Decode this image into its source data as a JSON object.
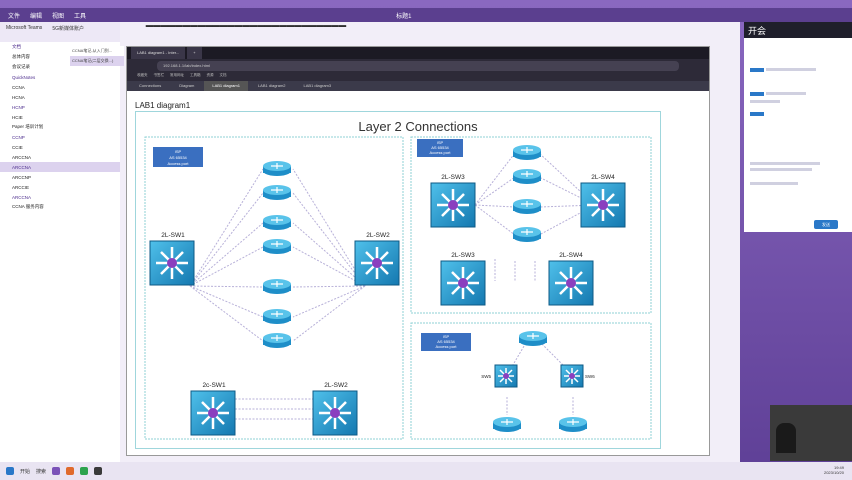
{
  "menu": {
    "items": [
      "文件",
      "编辑",
      "视图",
      "工具"
    ],
    "tab_center": "标题1"
  },
  "left_panel": {
    "header": [
      "Microsoft Teams",
      "5G新媒体账户"
    ],
    "items": [
      {
        "label": "文档",
        "selected": false
      },
      {
        "label": "总体内容",
        "selected": false
      },
      {
        "label": "会议记录",
        "selected": false
      },
      {
        "label": "QuickNotes",
        "selected": false
      },
      {
        "label": "CCNA",
        "selected": false
      },
      {
        "label": "HCNA",
        "selected": false
      },
      {
        "label": "HCNP",
        "selected": false
      },
      {
        "label": "HCIE",
        "selected": false
      },
      {
        "label": "Paper 培训计划",
        "selected": false
      },
      {
        "label": "CCNP",
        "selected": false
      },
      {
        "label": "CCIE",
        "selected": false
      },
      {
        "label": "ARCCNA",
        "selected": false
      },
      {
        "label": "ARCCNA",
        "selected": true
      },
      {
        "label": "ARCCNP",
        "selected": false
      },
      {
        "label": "ARCCIE",
        "selected": false
      },
      {
        "label": "ARCCNA",
        "selected": false
      },
      {
        "label": "CCNA 服务内容",
        "selected": false
      }
    ],
    "sub_header": [
      "CCNA笔记-从入门到...",
      "CCNA笔记(二层交换...)"
    ]
  },
  "browser": {
    "tabs": [
      "LAB1 diagram1 - Inter...",
      "+"
    ],
    "address": "192.168.1.1/lab/index.html",
    "bookmarks": [
      "收藏夹",
      "书签栏",
      "常用网址",
      "工具箱",
      "资源",
      "文档"
    ],
    "page_tabs": [
      "Connections",
      "Diagram",
      "LAB1 diagram1",
      "LAB1 diagram2",
      "LAB1 diagram3"
    ],
    "active_page_tab": 2
  },
  "diagram": {
    "label": "LAB1 diagram1",
    "title": "Layer 2 Connections",
    "left_block": {
      "note_lines": [
        "ISP",
        "AS 65534",
        "Access port"
      ],
      "switches": [
        "2L-SW1",
        "2L-SW2"
      ],
      "bottom_switches": [
        "2c-SW1",
        "2L-SW2"
      ]
    },
    "right_top_block": {
      "note_lines": [
        "ISP",
        "AS 65534",
        "Access port"
      ],
      "switches": [
        "2L-SW3",
        "2L-SW4"
      ],
      "bottom_switches": [
        "2L-SW3",
        "2L-SW4"
      ]
    },
    "right_bottom_block": {
      "note_lines": [
        "ISP",
        "AS 65534",
        "Access port"
      ],
      "labels": [
        "SW5",
        "SW6"
      ]
    }
  },
  "right_panel": {
    "title": "开会",
    "button": "发送"
  },
  "taskbar": {
    "items": [
      "开始",
      "搜索"
    ],
    "time": "19:49",
    "date": "2023/10/20"
  },
  "colors": {
    "frame": "#6a4a9c",
    "cyan_switch": "#1e9bd0",
    "note_blue": "#3a6fc0",
    "line": "#b7b0d8"
  }
}
